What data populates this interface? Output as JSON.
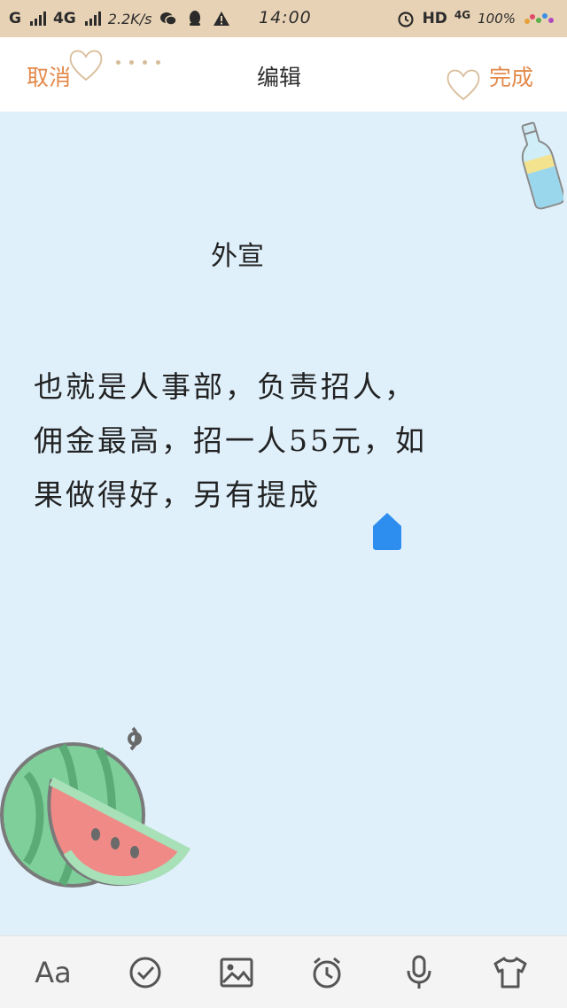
{
  "status_bar": {
    "carrier1": "G",
    "carrier2": "4G",
    "speed": "2.2K/s",
    "time": "14:00",
    "hd": "HD",
    "net2": "4G",
    "battery": "100%"
  },
  "header": {
    "cancel_label": "取消",
    "title": "编辑",
    "done_label": "完成"
  },
  "note": {
    "title": "外宣",
    "body_lines": [
      "也就是人事部，负责招人，",
      "佣金最高，招一人55元，如",
      "果做得好，另有提成"
    ]
  },
  "toolbar": {
    "font_label": "Aa",
    "items": [
      "font-icon",
      "check-circle-icon",
      "image-icon",
      "alarm-clock-icon",
      "microphone-icon",
      "shirt-icon"
    ]
  },
  "colors": {
    "status_bg": "#e7d2b5",
    "accent": "#e38a4b",
    "paper": "#dff0fb",
    "cursor": "#2e8ef0"
  }
}
